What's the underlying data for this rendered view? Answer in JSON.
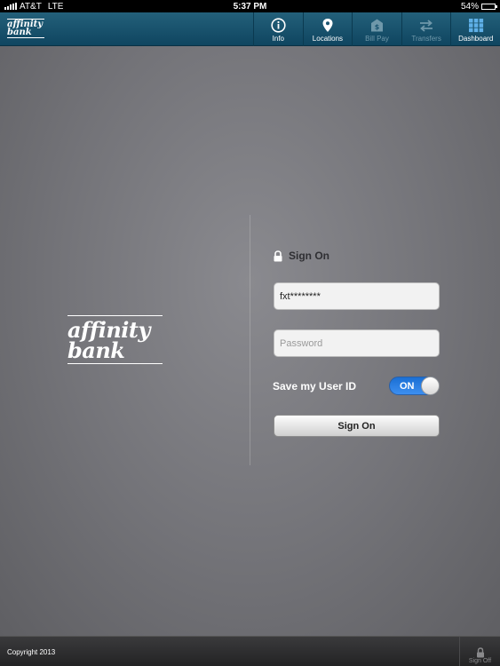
{
  "status_bar": {
    "carrier": "AT&T",
    "network": "LTE",
    "time": "5:37 PM",
    "battery": "54%",
    "battery_level": 0.54
  },
  "nav": {
    "logo_line1": "affinity",
    "logo_line2": "bank",
    "tabs": [
      {
        "label": "Info",
        "icon": "info-icon",
        "enabled": true
      },
      {
        "label": "Locations",
        "icon": "location-pin-icon",
        "enabled": true
      },
      {
        "label": "Bill Pay",
        "icon": "bill-pay-icon",
        "enabled": false
      },
      {
        "label": "Transfers",
        "icon": "transfer-arrows-icon",
        "enabled": false
      },
      {
        "label": "Dashboard",
        "icon": "dashboard-grid-icon",
        "enabled": true
      }
    ]
  },
  "brand": {
    "line1": "affinity",
    "line2": "bank"
  },
  "signon": {
    "title": "Sign On",
    "userid_value": "fxt********",
    "password_placeholder": "Password",
    "save_label": "Save my User ID",
    "toggle_label": "ON",
    "button_label": "Sign On"
  },
  "footer": {
    "copyright": "Copyright 2013",
    "signoff_label": "Sign Off"
  },
  "colors": {
    "nav_bg": "#1a5470",
    "toggle_on": "#2a7fe0"
  }
}
